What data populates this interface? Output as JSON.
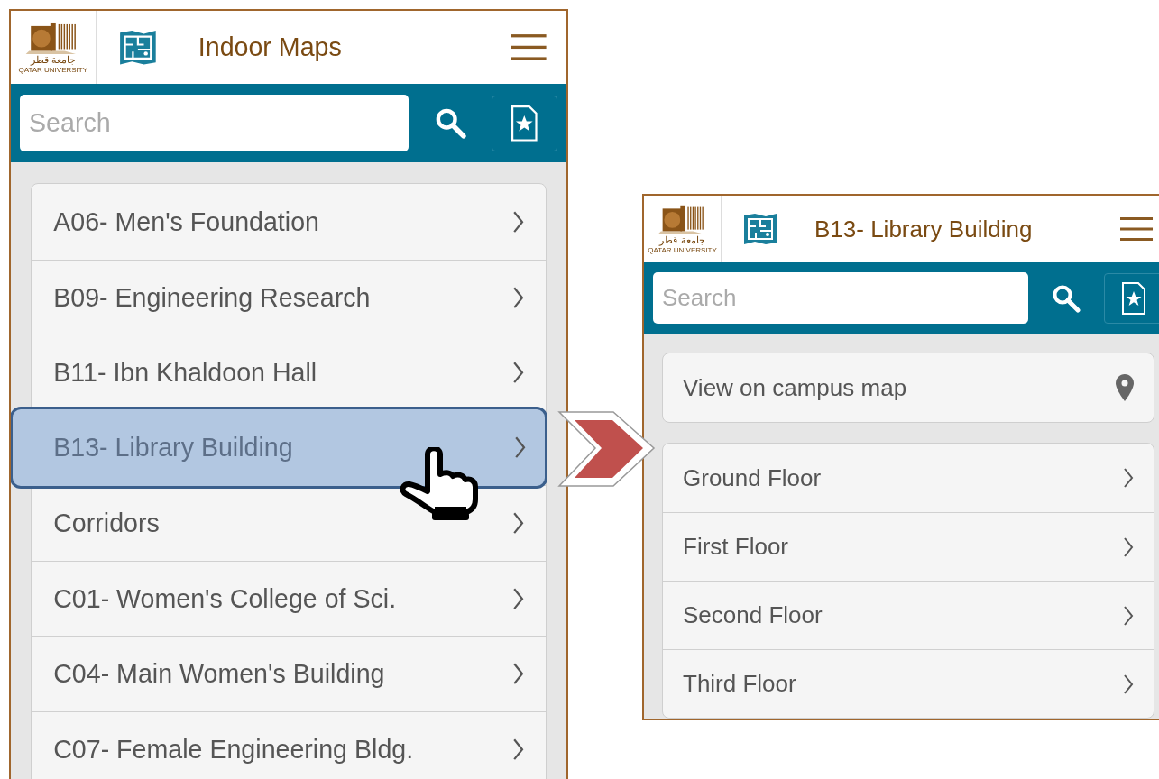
{
  "screens": [
    {
      "logo": {
        "arabic": "جامعة قطر",
        "english": "QATAR UNIVERSITY"
      },
      "title": "Indoor Maps",
      "search": {
        "placeholder": "Search"
      },
      "sections": [
        {
          "items": [
            {
              "kind": "nav",
              "label": "A06- Men's Foundation",
              "selected": false
            },
            {
              "kind": "nav",
              "label": "B09- Engineering Research",
              "selected": false
            },
            {
              "kind": "nav",
              "label": "B11- Ibn Khaldoon Hall",
              "selected": false
            },
            {
              "kind": "nav",
              "label": "B13- Library Building",
              "selected": true
            },
            {
              "kind": "nav",
              "label": "Corridors",
              "selected": false
            },
            {
              "kind": "nav",
              "label": "C01- Women's College of Sci.",
              "selected": false
            },
            {
              "kind": "nav",
              "label": "C04- Main Women's Building",
              "selected": false
            },
            {
              "kind": "nav",
              "label": "C07- Female Engineering Bldg.",
              "selected": false
            }
          ]
        }
      ]
    },
    {
      "logo": {
        "arabic": "جامعة قطر",
        "english": "QATAR UNIVERSITY"
      },
      "title": "B13- Library Building",
      "search": {
        "placeholder": "Search"
      },
      "sections": [
        {
          "items": [
            {
              "kind": "location",
              "label": "View on campus map",
              "selected": false
            }
          ]
        },
        {
          "items": [
            {
              "kind": "nav",
              "label": "Ground Floor",
              "selected": false
            },
            {
              "kind": "nav",
              "label": "First Floor",
              "selected": false
            },
            {
              "kind": "nav",
              "label": "Second Floor",
              "selected": false
            },
            {
              "kind": "nav",
              "label": "Third Floor",
              "selected": false
            }
          ]
        }
      ]
    }
  ]
}
